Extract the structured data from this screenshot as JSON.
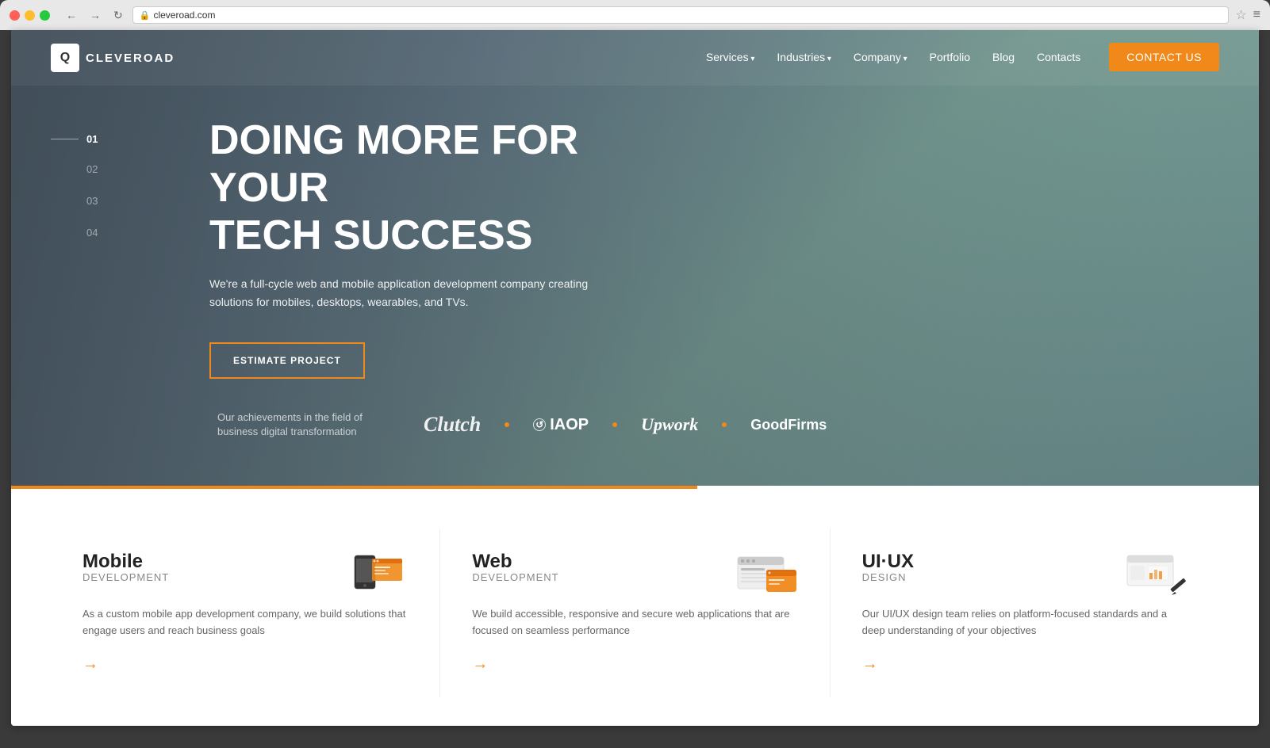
{
  "browser": {
    "address": "cleveroad.com",
    "back_label": "←",
    "forward_label": "→",
    "refresh_label": "↻",
    "bookmark_label": "☆",
    "menu_label": "≡"
  },
  "navbar": {
    "logo_text": "CLEVEROAD",
    "logo_icon": "Q",
    "nav_items": [
      {
        "label": "Services",
        "has_dropdown": true
      },
      {
        "label": "Industries",
        "has_dropdown": true
      },
      {
        "label": "Company",
        "has_dropdown": true
      },
      {
        "label": "Portfolio",
        "has_dropdown": false
      },
      {
        "label": "Blog",
        "has_dropdown": false
      },
      {
        "label": "Contacts",
        "has_dropdown": false
      }
    ],
    "cta_label": "CONTACT US"
  },
  "hero": {
    "slide_nums": [
      "01",
      "02",
      "03",
      "04"
    ],
    "title_line1": "DOING MORE FOR YOUR",
    "title_line2": "TECH SUCCESS",
    "description": "We're a full-cycle web and mobile application development company creating solutions for mobiles, desktops, wearables, and TVs.",
    "cta_label": "ESTIMATE PROJECT",
    "achievements_text": "Our achievements in the field of business digital transformation",
    "partners": [
      "Clutch",
      "IAOP",
      "Upwork",
      "GoodFirms"
    ]
  },
  "services": [
    {
      "title": "Mobile",
      "subtitle": "development",
      "description": "As a custom mobile app development company, we build solutions that engage users and reach business goals",
      "arrow": "→"
    },
    {
      "title": "Web",
      "subtitle": "development",
      "description": "We build accessible, responsive and secure web applications that are focused on seamless performance",
      "arrow": "→"
    },
    {
      "title": "UI·UX",
      "subtitle": "design",
      "description": "Our UI/UX design team relies on platform-focused standards and a deep understanding of your objectives",
      "arrow": "→"
    }
  ],
  "colors": {
    "accent": "#f0891a",
    "dark": "#222222",
    "text_muted": "#888888"
  }
}
